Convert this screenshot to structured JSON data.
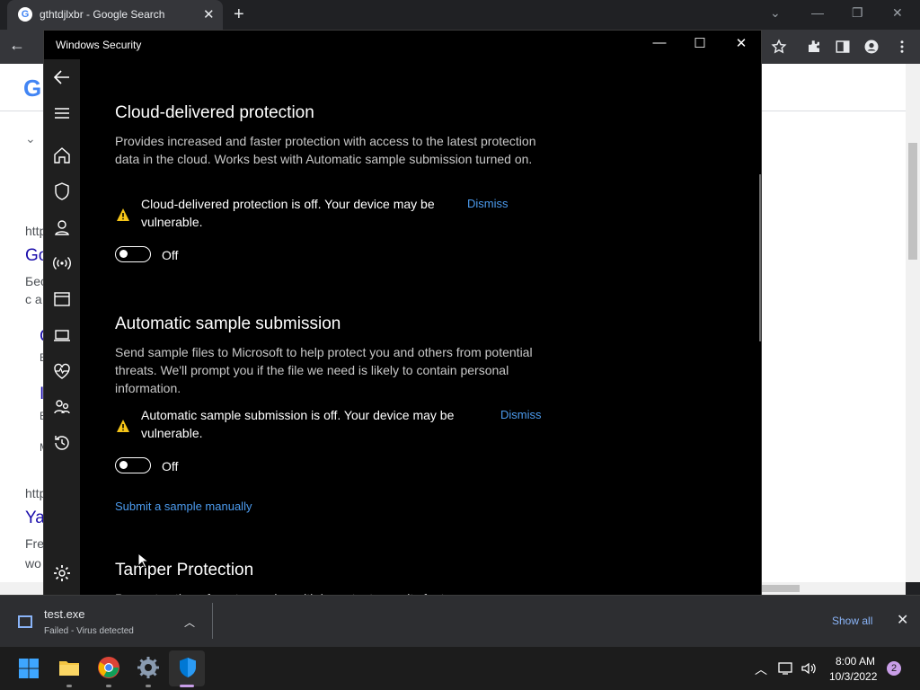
{
  "browser": {
    "tab_title": "gthtdjlxbr - Google Search",
    "tab_favicon": "G",
    "new_tab": "+",
    "close_tab": "✕"
  },
  "google_page": {
    "logo": "G",
    "fragments": [
      "http",
      "Go",
      "Бес",
      "c a",
      "C",
      "E",
      "I",
      "E",
      "M",
      "http",
      "Ya",
      "Fre",
      "wo"
    ]
  },
  "windows_security": {
    "window_title": "Windows Security",
    "sections": [
      {
        "title": "Cloud-delivered protection",
        "description": "Provides increased and faster protection with access to the latest protection data in the cloud. Works best with Automatic sample submission turned on.",
        "warning": "Cloud-delivered protection is off. Your device may be vulnerable.",
        "dismiss": "Dismiss",
        "toggle_state": "Off"
      },
      {
        "title": "Automatic sample submission",
        "description": "Send sample files to Microsoft to help protect you and others from potential threats. We'll prompt you if the file we need is likely to contain personal information.",
        "warning": "Automatic sample submission is off. Your device may be vulnerable.",
        "dismiss": "Dismiss",
        "toggle_state": "Off",
        "link": "Submit a sample manually"
      },
      {
        "title": "Tamper Protection",
        "description": "Prevents others from tampering with important security features."
      }
    ]
  },
  "download_bar": {
    "file_name": "test.exe",
    "status": "Failed - Virus detected",
    "show_all": "Show all"
  },
  "taskbar": {
    "time": "8:00 AM",
    "date": "10/3/2022",
    "notifications": "2"
  },
  "colors": {
    "accent_link": "#4c9bee",
    "warning": "#f5c518",
    "window_bg": "#000000"
  }
}
